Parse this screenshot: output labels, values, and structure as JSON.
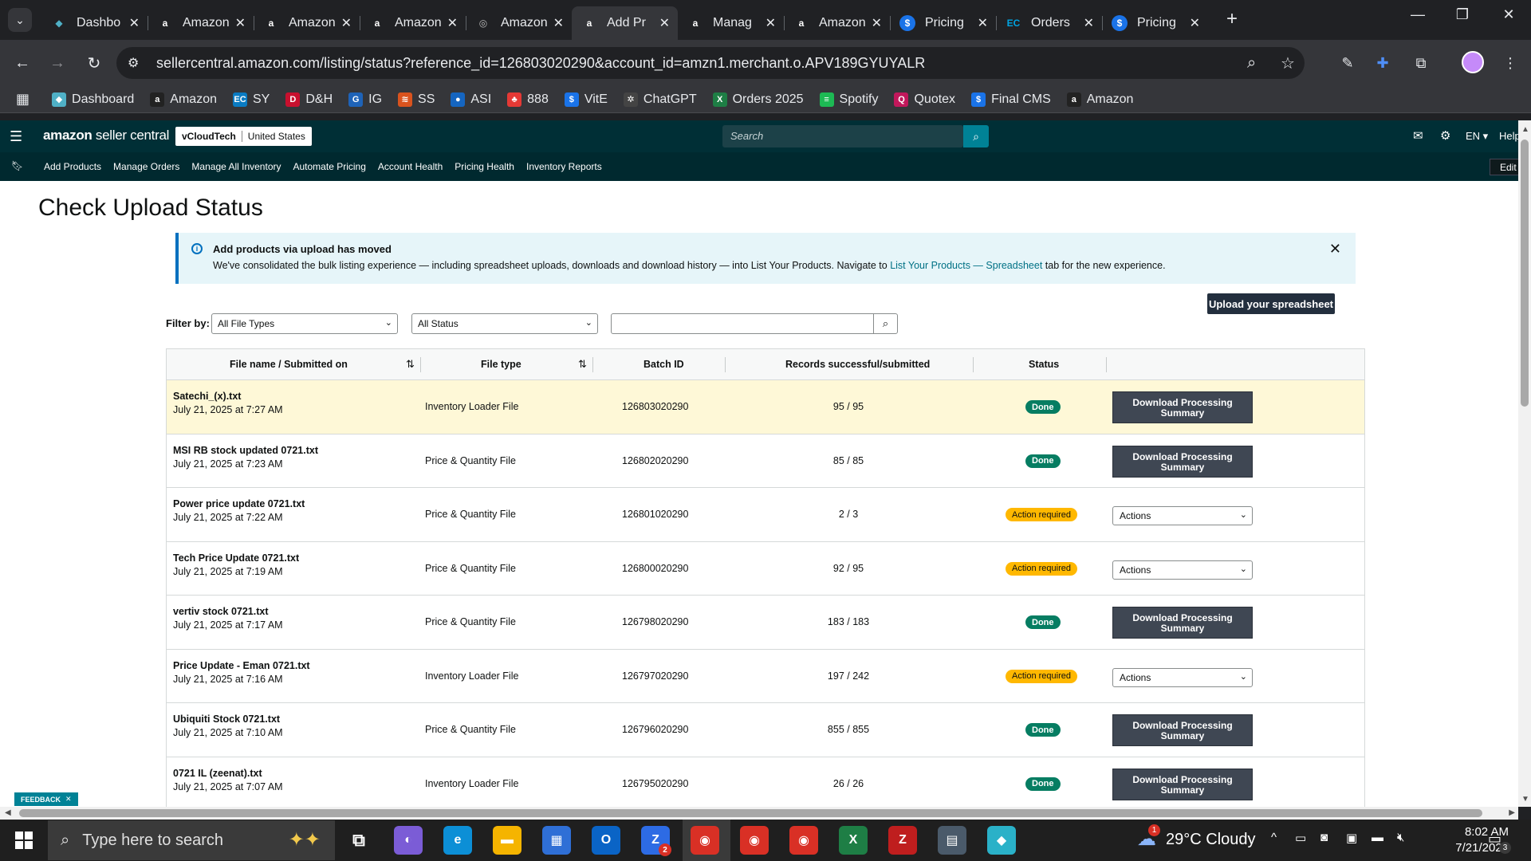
{
  "browser": {
    "tabs": [
      {
        "label": "Dashbo",
        "icon": "dashboard-favicon-icon",
        "color": "#4fb0c6",
        "active": false
      },
      {
        "label": "Amazon",
        "icon": "amazon-favicon-icon",
        "color": "#ffffff",
        "active": false
      },
      {
        "label": "Amazon",
        "icon": "amazon-favicon-icon",
        "color": "#ffffff",
        "active": false
      },
      {
        "label": "Amazon",
        "icon": "amazon-favicon-icon",
        "color": "#ffffff",
        "active": false
      },
      {
        "label": "Amazon",
        "icon": "spinner-favicon-icon",
        "color": "#bbbbbb",
        "active": false
      },
      {
        "label": "Add Pr",
        "icon": "amazon-favicon-icon",
        "color": "#ffffff",
        "active": true
      },
      {
        "label": "Manag",
        "icon": "amazon-favicon-icon",
        "color": "#ffffff",
        "active": false
      },
      {
        "label": "Amazon",
        "icon": "amazon-favicon-icon",
        "color": "#ffffff",
        "active": false
      },
      {
        "label": "Pricing",
        "icon": "dollar-favicon-icon",
        "color": "#1a73e8",
        "active": false
      },
      {
        "label": "Orders",
        "icon": "ec-favicon-icon",
        "color": "#00a3e0",
        "active": false
      },
      {
        "label": "Pricing",
        "icon": "dollar-favicon-icon",
        "color": "#1a73e8",
        "active": false
      }
    ],
    "url": "sellercentral.amazon.com/listing/status?reference_id=126803020290&account_id=amzn1.merchant.o.APV189GYUYALR",
    "bookmarks": [
      {
        "label": "Dashboard",
        "color": "#4fb0c6",
        "glyph": "◆"
      },
      {
        "label": "Amazon",
        "color": "#222222",
        "glyph": "a"
      },
      {
        "label": "SY",
        "color": "#0a7bc2",
        "glyph": "EC"
      },
      {
        "label": "D&H",
        "color": "#c8102e",
        "glyph": "D"
      },
      {
        "label": "IG",
        "color": "#1e63b8",
        "glyph": "G"
      },
      {
        "label": "SS",
        "color": "#d9531e",
        "glyph": "≋"
      },
      {
        "label": "ASI",
        "color": "#1565c0",
        "glyph": "●"
      },
      {
        "label": "888",
        "color": "#e53935",
        "glyph": "♣"
      },
      {
        "label": "VitE",
        "color": "#1a73e8",
        "glyph": "$"
      },
      {
        "label": "ChatGPT",
        "color": "#444444",
        "glyph": "✲"
      },
      {
        "label": "Orders 2025",
        "color": "#1e7e45",
        "glyph": "X"
      },
      {
        "label": "Spotify",
        "color": "#1db954",
        "glyph": "≡"
      },
      {
        "label": "Quotex",
        "color": "#c2185b",
        "glyph": "Q"
      },
      {
        "label": "Final CMS",
        "color": "#1a73e8",
        "glyph": "$"
      },
      {
        "label": "Amazon",
        "color": "#222222",
        "glyph": "a"
      }
    ]
  },
  "seller_central": {
    "logo_main": "amazon",
    "logo_sub": " seller central",
    "account_name": "vCloudTech",
    "marketplace": "United States",
    "search_placeholder": "Search",
    "language": "EN",
    "help": "Help",
    "nav": [
      "Add Products",
      "Manage Orders",
      "Manage All Inventory",
      "Automate Pricing",
      "Account Health",
      "Pricing Health",
      "Inventory Reports"
    ],
    "edit": "Edit"
  },
  "page": {
    "title": "Check Upload Status",
    "banner_title": "Add products via upload has moved",
    "banner_text_1": "We've consolidated the bulk listing experience — including spreadsheet uploads, downloads and download history — into List Your Products. Navigate to ",
    "banner_link": "List Your Products — Spreadsheet",
    "banner_text_2": " tab for the new experience.",
    "upload_button": "Upload your spreadsheet",
    "filter_label": "Filter by:",
    "filter_file_types": "All File Types",
    "filter_status": "All Status",
    "feedback": "FEEDBACK"
  },
  "table": {
    "headers": [
      "File name / Submitted on",
      "File type",
      "Batch ID",
      "Records successful/submitted",
      "Status"
    ],
    "download_label": "Download Processing Summary",
    "actions_label": "Actions",
    "rows": [
      {
        "name": "Satechi_(x).txt",
        "date": "July 21, 2025 at 7:27 AM",
        "type": "Inventory Loader File",
        "batch": "126803020290",
        "records": "95 / 95",
        "status": "Done",
        "kind": "done",
        "highlight": true
      },
      {
        "name": "MSI RB stock updated 0721.txt",
        "date": "July 21, 2025 at 7:23 AM",
        "type": "Price & Quantity File",
        "batch": "126802020290",
        "records": "85 / 85",
        "status": "Done",
        "kind": "done",
        "highlight": false
      },
      {
        "name": "Power price update 0721.txt",
        "date": "July 21, 2025 at 7:22 AM",
        "type": "Price & Quantity File",
        "batch": "126801020290",
        "records": "2 / 3",
        "status": "Action required",
        "kind": "action",
        "highlight": false
      },
      {
        "name": "Tech Price Update 0721.txt",
        "date": "July 21, 2025 at 7:19 AM",
        "type": "Price & Quantity File",
        "batch": "126800020290",
        "records": "92 / 95",
        "status": "Action required",
        "kind": "action",
        "highlight": false
      },
      {
        "name": "vertiv stock 0721.txt",
        "date": "July 21, 2025 at 7:17 AM",
        "type": "Price & Quantity File",
        "batch": "126798020290",
        "records": "183 / 183",
        "status": "Done",
        "kind": "done",
        "highlight": false
      },
      {
        "name": "Price Update - Eman 0721.txt",
        "date": "July 21, 2025 at 7:16 AM",
        "type": "Inventory Loader File",
        "batch": "126797020290",
        "records": "197 / 242",
        "status": "Action required",
        "kind": "action",
        "highlight": false
      },
      {
        "name": "Ubiquiti Stock 0721.txt",
        "date": "July 21, 2025 at 7:10 AM",
        "type": "Price & Quantity File",
        "batch": "126796020290",
        "records": "855 / 855",
        "status": "Done",
        "kind": "done",
        "highlight": false
      },
      {
        "name": "0721 IL (zeenat).txt",
        "date": "July 21, 2025 at 7:07 AM",
        "type": "Inventory Loader File",
        "batch": "126795020290",
        "records": "26 / 26",
        "status": "Done",
        "kind": "done",
        "highlight": false
      }
    ]
  },
  "taskbar": {
    "search_placeholder": "Type here to search",
    "weather": "29°C  Cloudy",
    "weather_badge": "1",
    "time": "8:02 AM",
    "date": "7/21/2025",
    "notif_count": "3",
    "outlook_badge": "2",
    "apps": [
      {
        "name": "task-view-icon",
        "glyph": "⧉",
        "color": "transparent"
      },
      {
        "name": "copilot-icon",
        "glyph": "◐",
        "color": "#7b5cd6"
      },
      {
        "name": "edge-icon",
        "glyph": "e",
        "color": "#0c8fd6"
      },
      {
        "name": "file-explorer-icon",
        "glyph": "▬",
        "color": "#f5b400"
      },
      {
        "name": "store-icon",
        "glyph": "▦",
        "color": "#2f6fd6"
      },
      {
        "name": "outlook-icon",
        "glyph": "O",
        "color": "#0a64c6"
      },
      {
        "name": "zoom-icon",
        "glyph": "Z",
        "color": "#2d6be4"
      },
      {
        "name": "chrome-icon",
        "glyph": "◉",
        "color": "#d93025"
      },
      {
        "name": "chrome-profile-icon",
        "glyph": "◉",
        "color": "#d93025"
      },
      {
        "name": "chrome-2-icon",
        "glyph": "◉",
        "color": "#d93025"
      },
      {
        "name": "excel-icon",
        "glyph": "X",
        "color": "#1e7e45"
      },
      {
        "name": "filezilla-icon",
        "glyph": "Z",
        "color": "#bf1e1e"
      },
      {
        "name": "calculator-icon",
        "glyph": "▤",
        "color": "#4a5a6a"
      },
      {
        "name": "app-diamond-icon",
        "glyph": "◆",
        "color": "#2ab1c8"
      }
    ]
  }
}
